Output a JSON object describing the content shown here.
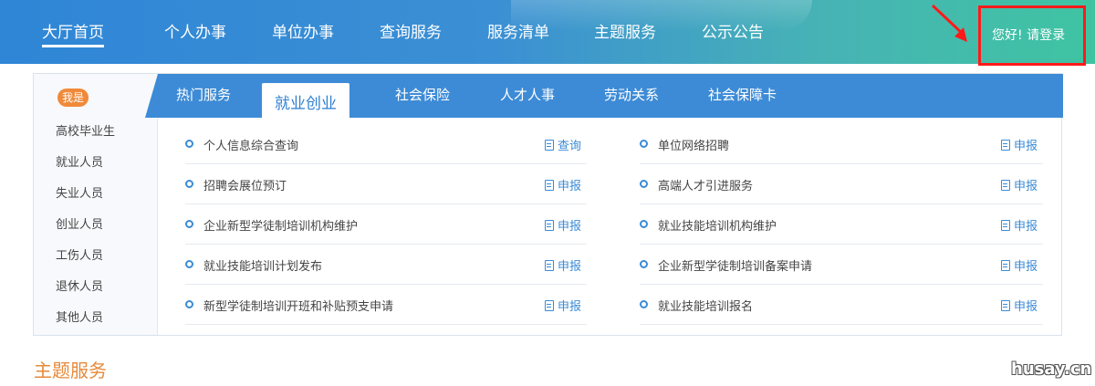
{
  "nav": {
    "items": [
      "大厅首页",
      "个人办事",
      "单位办事",
      "查询服务",
      "服务清单",
      "主题服务",
      "公示公告"
    ],
    "greeting": "您好!",
    "login": "请登录"
  },
  "sidebar": {
    "badge": "我是",
    "items": [
      "高校毕业生",
      "就业人员",
      "失业人员",
      "创业人员",
      "工伤人员",
      "退休人员",
      "其他人员"
    ]
  },
  "tabs": [
    "热门服务",
    "就业创业",
    "社会保险",
    "人才人事",
    "劳动关系",
    "社会保障卡"
  ],
  "services": {
    "left": [
      {
        "name": "个人信息综合查询",
        "action": "查询"
      },
      {
        "name": "招聘会展位预订",
        "action": "申报"
      },
      {
        "name": "企业新型学徒制培训机构维护",
        "action": "申报"
      },
      {
        "name": "就业技能培训计划发布",
        "action": "申报"
      },
      {
        "name": "新型学徒制培训开班和补贴预支申请",
        "action": "申报"
      }
    ],
    "right": [
      {
        "name": "单位网络招聘",
        "action": "申报"
      },
      {
        "name": "高端人才引进服务",
        "action": "申报"
      },
      {
        "name": "就业技能培训机构维护",
        "action": "申报"
      },
      {
        "name": "企业新型学徒制培训备案申请",
        "action": "申报"
      },
      {
        "name": "就业技能培训报名",
        "action": "申报"
      }
    ]
  },
  "section": {
    "title": "主题服务"
  },
  "watermark": "husay.cn",
  "colors": {
    "accent": "#3d8bd6",
    "highlight": "#ff1a1a",
    "section": "#e68a3a"
  }
}
